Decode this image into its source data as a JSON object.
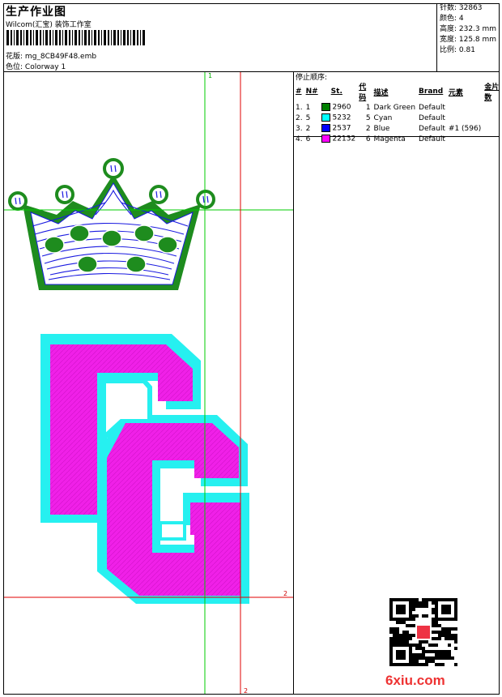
{
  "header": {
    "title": "生产作业图",
    "company": "Wilcom(汇宝) 装饰工作室",
    "design_label": "花版:",
    "design_value": "mg_8CB49F48.emb",
    "colorway_label": "色位:",
    "colorway_value": "Colorway 1"
  },
  "stats": {
    "stitches": "针数: 32863",
    "colors": "颜色: 4",
    "height": "高度: 232.3 mm",
    "width": "宽度: 125.8 mm",
    "scale": "比例: 0.81"
  },
  "stop_sequence": {
    "title": "停止顺序:",
    "headers": [
      "#",
      "N#",
      "St.",
      "代码",
      "描述",
      "Brand",
      "元素",
      "金片数"
    ],
    "rows": [
      {
        "idx": "1.",
        "n": "1",
        "st": "2960",
        "code": "1",
        "desc": "Dark Green",
        "brand": "Default",
        "elem": "",
        "seq": "",
        "color": "#008000"
      },
      {
        "idx": "2.",
        "n": "5",
        "st": "5232",
        "code": "5",
        "desc": "Cyan",
        "brand": "Default",
        "elem": "",
        "seq": "",
        "color": "#00ffff"
      },
      {
        "idx": "3.",
        "n": "2",
        "st": "2537",
        "code": "2",
        "desc": "Blue",
        "brand": "Default",
        "elem": "#1 (596)",
        "seq": "",
        "color": "#0000ff"
      },
      {
        "idx": "4.",
        "n": "6",
        "st": "22132",
        "code": "6",
        "desc": "Magenta",
        "brand": "Default",
        "elem": "",
        "seq": "",
        "color": "#ff00ff"
      }
    ]
  },
  "guides": {
    "green_label": "1",
    "red_label_right": "2",
    "red_label_bottom": "2"
  },
  "watermark": "6xiu.com",
  "colors": {
    "crown_green": "#1e8c1e",
    "crown_blue": "#1a1ae0",
    "letter_cyan": "#26f0f0",
    "letter_magenta": "#f020e8",
    "guide_green": "#00cc00",
    "guide_red": "#e00000"
  }
}
